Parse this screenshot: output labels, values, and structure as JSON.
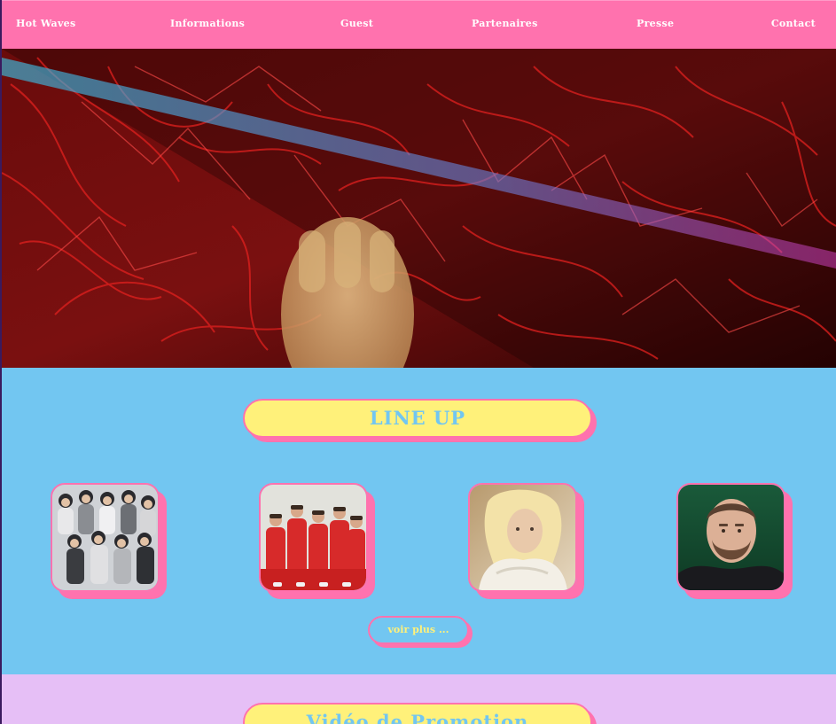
{
  "nav": {
    "items": [
      {
        "label": "Hot Waves"
      },
      {
        "label": "Informations"
      },
      {
        "label": "Guest"
      },
      {
        "label": "Partenaires"
      },
      {
        "label": "Presse"
      },
      {
        "label": "Contact"
      }
    ]
  },
  "lineup": {
    "title": "LINE UP",
    "more_label": "voir plus ..."
  },
  "promo": {
    "title": "Vidéo de Promotion"
  },
  "colors": {
    "nav_bg": "#ff72ae",
    "lineup_bg": "#72c6f1",
    "pill_bg": "#fff17a",
    "accent_pink": "#ff72ae",
    "promo_bg": "#e6bff6"
  }
}
